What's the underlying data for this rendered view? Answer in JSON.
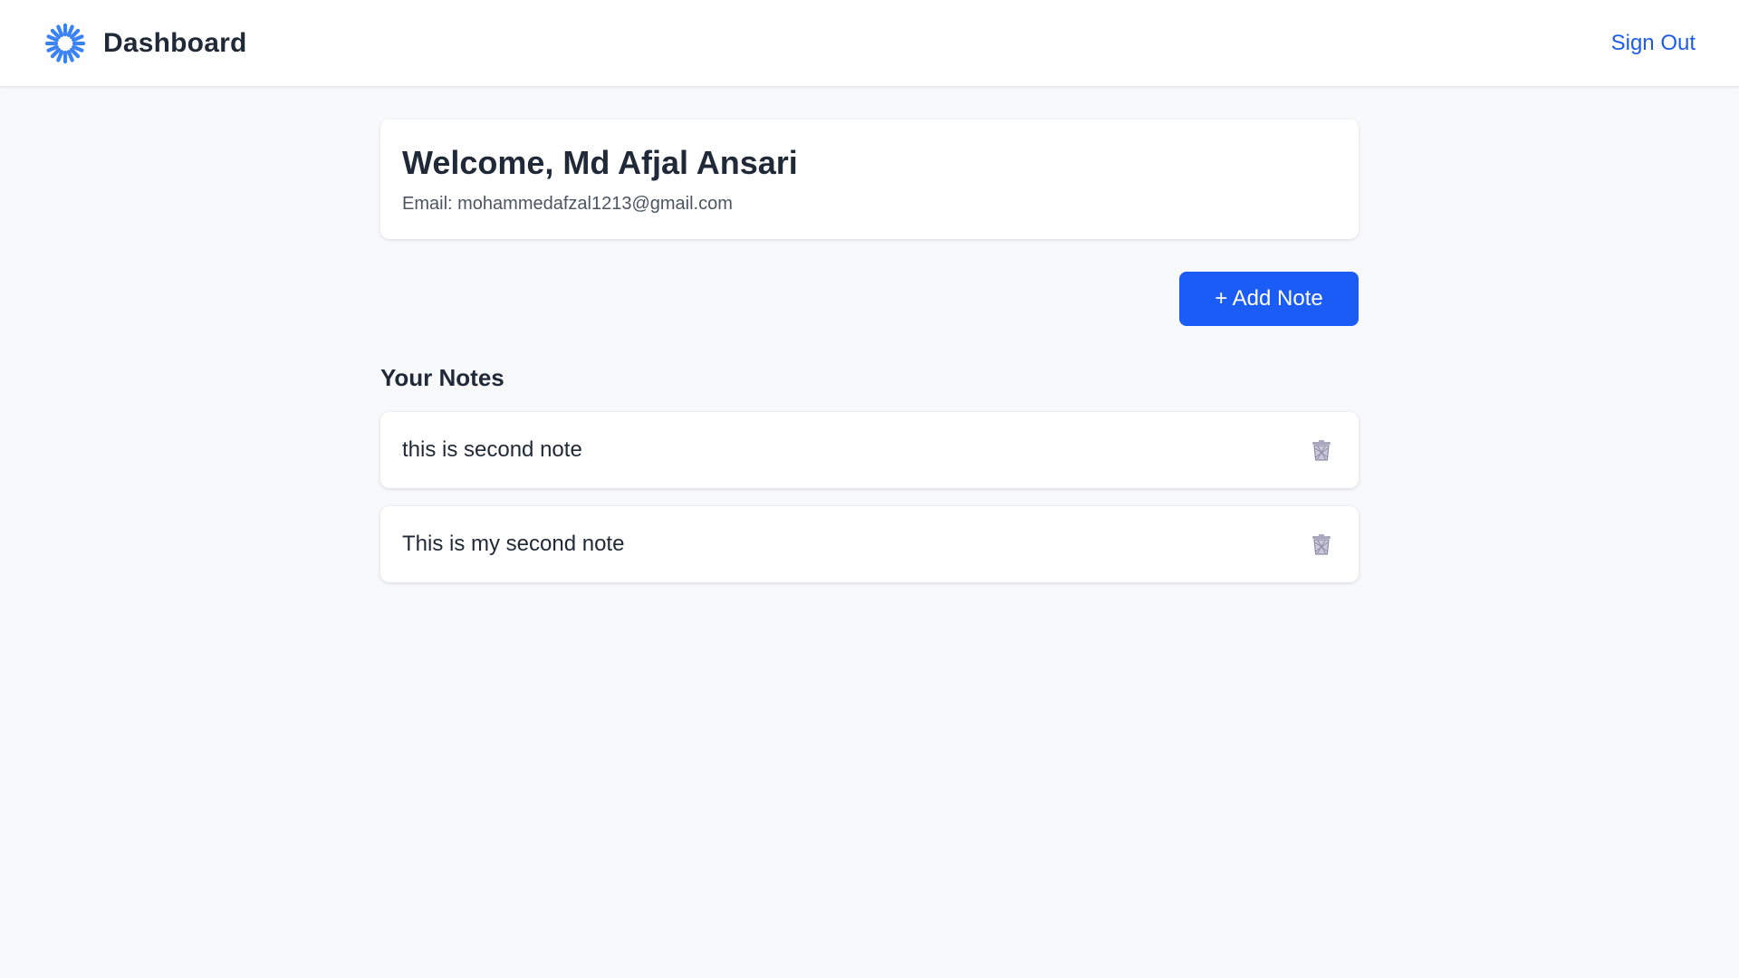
{
  "header": {
    "logo_icon": "spinner-sun-icon",
    "title": "Dashboard",
    "sign_out_label": "Sign Out"
  },
  "welcome": {
    "title": "Welcome, Md Afjal Ansari",
    "email_line": "Email: mohammedafzal1213@gmail.com"
  },
  "actions": {
    "add_note_label": "+ Add Note"
  },
  "notes_section": {
    "title": "Your Notes",
    "notes": [
      {
        "text": "this is second note",
        "delete_icon": "trash-icon"
      },
      {
        "text": "This is my second note",
        "delete_icon": "trash-icon"
      }
    ]
  },
  "colors": {
    "accent": "#1a5cf5",
    "link": "#1d5ce6",
    "background": "#f8f9fb",
    "logo": "#3b82f6"
  }
}
